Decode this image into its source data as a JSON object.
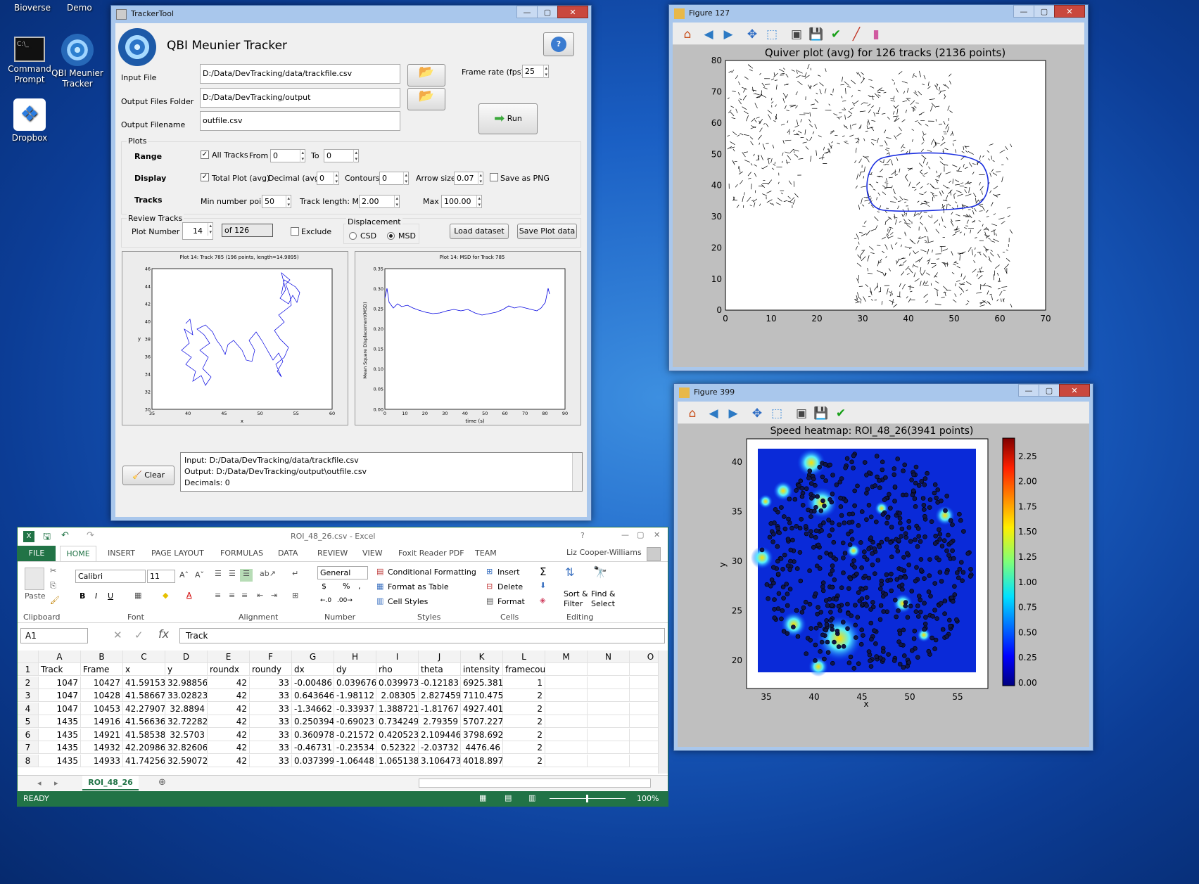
{
  "desktop": {
    "top_labels": [
      "Bioverse",
      "Demo"
    ],
    "icons": [
      {
        "label": "Command\nPrompt"
      },
      {
        "label": "QBI Meunier\nTracker"
      },
      {
        "label": "Dropbox"
      }
    ]
  },
  "tracker": {
    "window_title": "TrackerTool",
    "app_title": "QBI Meunier Tracker",
    "input_file_label": "Input File",
    "input_file_value": "D:/Data/DevTracking/data/trackfile.csv",
    "output_folder_label": "Output Files Folder",
    "output_folder_value": "D:/Data/DevTracking/output",
    "output_filename_label": "Output Filename",
    "output_filename_value": "outfile.csv",
    "frame_rate_label": "Frame rate (fps)",
    "frame_rate_value": "25",
    "run_label": "Run",
    "plots_label": "Plots",
    "range_label": "Range",
    "all_tracks_label": "All Tracks",
    "from_label": "From",
    "from_value": "0",
    "to_label": "To",
    "to_value": "0",
    "display_label": "Display",
    "total_plot_label": "Total Plot (avg)",
    "decimal_label": "Decimal (avg)",
    "decimal_value": "0",
    "contours_label": "Contours",
    "contours_value": "0",
    "arrow_size_label": "Arrow size",
    "arrow_size_value": "0.07",
    "save_png_label": "Save as PNG",
    "tracks_label": "Tracks",
    "min_points_label": "Min number points",
    "min_points_value": "50",
    "track_length_label": "Track length: Min",
    "track_length_value": "2.00",
    "max_label": "Max",
    "max_value": "100.00",
    "review_label": "Review Tracks",
    "plot_number_label": "Plot Number",
    "plot_number_value": "14",
    "of_label": "of 126",
    "exclude_label": "Exclude",
    "displacement_label": "Displacement",
    "csd_label": "CSD",
    "msd_label": "MSD",
    "load_label": "Load dataset",
    "save_plot_label": "Save Plot data",
    "clear_label": "Clear",
    "log_lines": [
      "Input: D:/Data/DevTracking/data/trackfile.csv",
      "Output: D:/Data/DevTracking/output\\outfile.csv",
      "Decimals: 0"
    ],
    "track_plot": {
      "title": "Plot 14: Track 785 (196 points, length=14.9895)",
      "xlabel": "x",
      "ylabel": "y",
      "xticks": [
        "35",
        "40",
        "45",
        "50",
        "55",
        "60"
      ],
      "yticks": [
        "30",
        "32",
        "34",
        "36",
        "38",
        "40",
        "42",
        "44",
        "46"
      ]
    },
    "msd_plot": {
      "title": "Plot 14: MSD for Track 785",
      "xlabel": "time (s)",
      "ylabel": "Mean Square Displacement(MSD)",
      "xticks": [
        "0",
        "10",
        "20",
        "30",
        "40",
        "50",
        "60",
        "70",
        "80",
        "90"
      ],
      "yticks": [
        "0.00",
        "0.05",
        "0.10",
        "0.15",
        "0.20",
        "0.25",
        "0.30",
        "0.35"
      ]
    }
  },
  "fig127": {
    "window_title": "Figure 127",
    "plot_title": "Quiver plot (avg) for 126 tracks (2136 points)",
    "xticks": [
      "0",
      "10",
      "20",
      "30",
      "40",
      "50",
      "60",
      "70"
    ],
    "yticks": [
      "0",
      "10",
      "20",
      "30",
      "40",
      "50",
      "60",
      "70",
      "80"
    ]
  },
  "fig399": {
    "window_title": "Figure 399",
    "plot_title": "Speed heatmap: ROI_48_26(3941 points)",
    "xlabel": "x",
    "ylabel": "y",
    "xticks": [
      "35",
      "40",
      "45",
      "50",
      "55"
    ],
    "yticks": [
      "20",
      "25",
      "30",
      "35",
      "40"
    ],
    "cbar_ticks": [
      "0.00",
      "0.25",
      "0.50",
      "0.75",
      "1.00",
      "1.25",
      "1.50",
      "1.75",
      "2.00",
      "2.25"
    ]
  },
  "excel": {
    "window_title": "ROI_48_26.csv - Excel",
    "user": "Liz Cooper-Williams",
    "ribbon_tabs": [
      "FILE",
      "HOME",
      "INSERT",
      "PAGE LAYOUT",
      "FORMULAS",
      "DATA",
      "REVIEW",
      "VIEW",
      "Foxit Reader PDF",
      "TEAM"
    ],
    "paste_label": "Paste",
    "font_name": "Calibri",
    "font_size": "11",
    "number_format": "General",
    "cond_format_label": "Conditional Formatting",
    "format_table_label": "Format as Table",
    "cell_styles_label": "Cell Styles",
    "insert_label": "Insert",
    "delete_label": "Delete",
    "format_label": "Format",
    "sort_label": "Sort &\nFilter",
    "find_label": "Find &\nSelect",
    "groups": [
      "Clipboard",
      "Font",
      "Alignment",
      "Number",
      "Styles",
      "Cells",
      "Editing"
    ],
    "name_box": "A1",
    "formula": "Track",
    "col_letters": [
      "A",
      "B",
      "C",
      "D",
      "E",
      "F",
      "G",
      "H",
      "I",
      "J",
      "K",
      "L",
      "M",
      "N",
      "O"
    ],
    "headers": [
      "Track",
      "Frame",
      "x",
      "y",
      "roundx",
      "roundy",
      "dx",
      "dy",
      "rho",
      "theta",
      "intensity",
      "framecount"
    ],
    "rows": [
      [
        "1047",
        "10427",
        "41.59153",
        "32.98856",
        "42",
        "33",
        "-0.00486",
        "0.039676",
        "0.039973",
        "-0.12183",
        "6925.381",
        "1"
      ],
      [
        "1047",
        "10428",
        "41.58667",
        "33.02823",
        "42",
        "33",
        "0.643646",
        "-1.98112",
        "2.08305",
        "2.827459",
        "7110.475",
        "2"
      ],
      [
        "1047",
        "10453",
        "42.27907",
        "32.8894",
        "42",
        "33",
        "-1.34662",
        "-0.33937",
        "1.388721",
        "-1.81767",
        "4927.401",
        "2"
      ],
      [
        "1435",
        "14916",
        "41.56636",
        "32.72282",
        "42",
        "33",
        "0.250394",
        "-0.69023",
        "0.734249",
        "2.79359",
        "5707.227",
        "2"
      ],
      [
        "1435",
        "14921",
        "41.58538",
        "32.5703",
        "42",
        "33",
        "0.360978",
        "-0.21572",
        "0.420523",
        "2.109446",
        "3798.692",
        "2"
      ],
      [
        "1435",
        "14932",
        "42.20986",
        "32.82606",
        "42",
        "33",
        "-0.46731",
        "-0.23534",
        "0.52322",
        "-2.03732",
        "4476.46",
        "2"
      ],
      [
        "1435",
        "14933",
        "41.74256",
        "32.59072",
        "42",
        "33",
        "0.037399",
        "-1.06448",
        "1.065138",
        "3.106473",
        "4018.897",
        "2"
      ]
    ],
    "sheet_tab": "ROI_48_26",
    "status": "READY",
    "zoom": "100%"
  }
}
